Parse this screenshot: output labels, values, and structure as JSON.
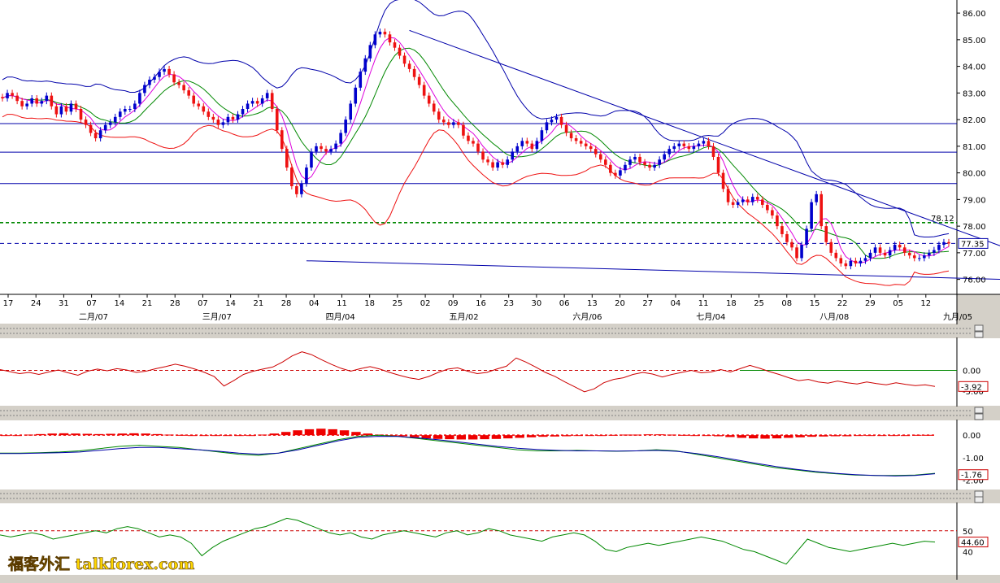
{
  "colors": {
    "bg": "#ffffff",
    "up_candle": "#0000cc",
    "down_candle": "#ee1111",
    "bollinger": "#0000aa",
    "ma_fast": "#dd00dd",
    "ma_slow": "#008800",
    "grid_hline": "#0000aa",
    "support_line": "#008800",
    "price_line": "#0000aa",
    "osc1": "#cc0000",
    "macd_signal": "#008800",
    "macd_line": "#0000aa",
    "macd_hist": "#ee0000",
    "rsi": "#008800"
  },
  "chart_data": [
    {
      "type": "candlestick",
      "y_ticks": [
        "86.00",
        "85.00",
        "84.00",
        "83.00",
        "82.00",
        "81.00",
        "80.00",
        "79.00",
        "78.00",
        "77.00",
        "76.00"
      ],
      "ylim": [
        75.5,
        86.4
      ],
      "x_ticks": [
        "17",
        "24",
        "31",
        "07",
        "14",
        "21",
        "28",
        "07",
        "14",
        "21",
        "28",
        "04",
        "11",
        "18",
        "25",
        "02",
        "09",
        "16",
        "23",
        "30",
        "06",
        "13",
        "20",
        "27",
        "04",
        "11",
        "18",
        "25",
        "08",
        "15",
        "22",
        "29",
        "05",
        "12"
      ],
      "month_labels": [
        "二月/07",
        "三月/07",
        "四月/04",
        "五月/02",
        "六月/06",
        "七月/04",
        "八月/08",
        "九月/05"
      ],
      "horizontal_levels": [
        81.85,
        80.78,
        79.6
      ],
      "reference_level": {
        "value": 78.13,
        "label": "78.12"
      },
      "current_price": {
        "value": 77.35,
        "label": "77.35"
      },
      "trendlines": [
        {
          "from": {
            "bar": 83,
            "value": 85.35
          },
          "to": {
            "bar": 229,
            "value": 75.55
          }
        },
        {
          "from": {
            "bar": 62,
            "value": 76.7
          },
          "to": {
            "bar": 245,
            "value": 75.8
          }
        }
      ],
      "close_series": [
        82.8,
        83.0,
        82.9,
        82.7,
        82.5,
        82.6,
        82.8,
        82.6,
        82.7,
        82.9,
        82.5,
        82.2,
        82.5,
        82.3,
        82.6,
        82.4,
        82.0,
        81.8,
        81.5,
        81.3,
        81.6,
        81.8,
        81.9,
        82.1,
        82.3,
        82.4,
        82.4,
        82.6,
        83.0,
        83.3,
        83.5,
        83.6,
        83.8,
        83.9,
        83.7,
        83.4,
        83.3,
        83.1,
        82.9,
        82.6,
        82.5,
        82.3,
        82.1,
        82.0,
        81.8,
        81.9,
        82.1,
        82.0,
        82.2,
        82.4,
        82.6,
        82.7,
        82.6,
        82.8,
        83.0,
        82.4,
        81.6,
        80.9,
        80.2,
        79.5,
        79.2,
        79.6,
        80.2,
        80.8,
        81.0,
        80.9,
        80.8,
        80.9,
        81.1,
        81.5,
        82.0,
        82.6,
        83.2,
        83.8,
        84.3,
        84.8,
        85.2,
        85.3,
        85.2,
        84.9,
        84.7,
        84.4,
        84.1,
        83.9,
        83.6,
        83.3,
        82.9,
        82.6,
        82.3,
        82.0,
        81.9,
        81.8,
        81.9,
        81.8,
        81.4,
        81.2,
        81.1,
        80.8,
        80.5,
        80.4,
        80.2,
        80.4,
        80.3,
        80.5,
        80.8,
        81.0,
        81.2,
        81.1,
        80.9,
        81.2,
        81.6,
        81.9,
        82.0,
        82.1,
        81.8,
        81.5,
        81.3,
        81.2,
        81.1,
        81.0,
        80.9,
        80.7,
        80.5,
        80.3,
        80.0,
        79.9,
        80.1,
        80.3,
        80.5,
        80.6,
        80.4,
        80.3,
        80.2,
        80.3,
        80.5,
        80.7,
        80.9,
        81.0,
        81.1,
        81.0,
        80.9,
        81.0,
        81.1,
        81.2,
        81.0,
        80.6,
        80.0,
        79.4,
        78.9,
        78.8,
        78.9,
        79.0,
        78.9,
        79.1,
        79.0,
        78.8,
        78.6,
        78.4,
        78.0,
        77.7,
        77.4,
        77.2,
        76.8,
        77.3,
        77.9,
        78.9,
        79.2,
        78.0,
        77.4,
        77.0,
        76.8,
        76.6,
        76.5,
        76.7,
        76.6,
        76.7,
        76.8,
        77.0,
        77.2,
        77.0,
        76.9,
        77.1,
        77.3,
        77.2,
        77.0,
        76.9,
        76.8,
        76.8,
        76.9,
        77.0,
        77.1,
        77.3,
        77.4,
        77.35
      ]
    },
    {
      "type": "line",
      "y_ticks": [
        "0.00",
        "-5.00"
      ],
      "current_value": "-3.92",
      "series": [
        {
          "values": [
            0.2,
            -0.3,
            -0.8,
            -0.5,
            -1.0,
            -0.4,
            0.1,
            -0.6,
            -1.2,
            -0.2,
            0.3,
            -0.1,
            0.4,
            0.1,
            -0.5,
            -0.2,
            0.4,
            0.9,
            1.5,
            1.0,
            0.3,
            -0.5,
            -1.5,
            -3.8,
            -2.5,
            -1.0,
            -0.2,
            0.3,
            0.8,
            2.0,
            3.5,
            4.5,
            3.8,
            2.6,
            1.5,
            0.5,
            -0.2,
            0.4,
            0.9,
            0.3,
            -0.5,
            -1.2,
            -1.8,
            -2.2,
            -1.5,
            -0.5,
            0.3,
            0.6,
            -0.2,
            -0.8,
            -0.5,
            0.3,
            1.0,
            3.0,
            2.0,
            0.8,
            -0.5,
            -1.5,
            -2.8,
            -4.0,
            -5.2,
            -4.5,
            -3.0,
            -2.2,
            -1.8,
            -1.0,
            -0.5,
            -0.9,
            -1.6,
            -1.0,
            -0.5,
            0.0,
            -0.6,
            -0.4,
            0.2,
            -0.4,
            0.4,
            1.2,
            0.5,
            -0.3,
            -1.0,
            -1.8,
            -2.5,
            -2.2,
            -2.8,
            -3.1,
            -2.6,
            -3.0,
            -3.3,
            -2.8,
            -3.2,
            -3.5,
            -3.0,
            -3.4,
            -3.7,
            -3.5,
            -3.92
          ]
        }
      ]
    },
    {
      "type": "line",
      "y_ticks": [
        "0.00",
        "-1.00",
        "-2.00"
      ],
      "current_value": "-1.76",
      "series": [
        {
          "values": [
            -0.8,
            -0.8,
            -0.78,
            -0.75,
            -0.7,
            -0.6,
            -0.5,
            -0.45,
            -0.5,
            -0.55,
            -0.65,
            -0.75,
            -0.85,
            -0.9,
            -0.8,
            -0.6,
            -0.4,
            -0.2,
            -0.05,
            0.0,
            -0.05,
            -0.15,
            -0.25,
            -0.35,
            -0.45,
            -0.55,
            -0.65,
            -0.7,
            -0.7,
            -0.68,
            -0.7,
            -0.72,
            -0.7,
            -0.65,
            -0.7,
            -0.85,
            -1.0,
            -1.15,
            -1.3,
            -1.45,
            -1.55,
            -1.65,
            -1.72,
            -1.78,
            -1.8,
            -1.8,
            -1.78,
            -1.7
          ]
        },
        {
          "values": [
            -0.82,
            -0.82,
            -0.8,
            -0.78,
            -0.75,
            -0.68,
            -0.6,
            -0.55,
            -0.55,
            -0.6,
            -0.65,
            -0.72,
            -0.8,
            -0.85,
            -0.8,
            -0.65,
            -0.45,
            -0.25,
            -0.1,
            -0.05,
            -0.06,
            -0.12,
            -0.2,
            -0.3,
            -0.4,
            -0.5,
            -0.58,
            -0.64,
            -0.68,
            -0.7,
            -0.7,
            -0.71,
            -0.7,
            -0.68,
            -0.72,
            -0.82,
            -0.95,
            -1.1,
            -1.25,
            -1.4,
            -1.52,
            -1.62,
            -1.7,
            -1.76,
            -1.8,
            -1.82,
            -1.8,
            -1.72
          ]
        }
      ],
      "histogram": [
        -0.02,
        -0.01,
        0.02,
        0.04,
        0.06,
        0.07,
        0.06,
        0.05,
        0.04,
        0.05,
        0.06,
        0.07,
        0.06,
        0.04,
        0.02,
        0.01,
        0.0,
        0.0,
        -0.01,
        -0.02,
        -0.02,
        -0.01,
        0.02,
        0.06,
        0.12,
        0.18,
        0.22,
        0.24,
        0.22,
        0.18,
        0.12,
        0.06,
        0.02,
        -0.01,
        -0.04,
        -0.08,
        -0.12,
        -0.14,
        -0.15,
        -0.16,
        -0.16,
        -0.15,
        -0.14,
        -0.12,
        -0.1,
        -0.08,
        -0.06,
        -0.05,
        -0.04,
        -0.03,
        -0.02,
        0.0,
        0.01,
        0.02,
        0.02,
        0.03,
        0.03,
        0.02,
        0.01,
        0.0,
        -0.02,
        -0.04,
        -0.07,
        -0.1,
        -0.12,
        -0.13,
        -0.12,
        -0.1,
        -0.08,
        -0.06,
        -0.05,
        -0.04,
        -0.04,
        -0.03,
        -0.02,
        -0.01,
        0.0,
        0.0,
        0.01,
        0.01
      ]
    },
    {
      "type": "line",
      "y_ticks": [
        "50",
        "40"
      ],
      "reference_level": "50",
      "current_value": "44.60",
      "series": [
        {
          "values": [
            48,
            47,
            48,
            49,
            48,
            46,
            47,
            48,
            49,
            50,
            49,
            51,
            52,
            51,
            49,
            47,
            48,
            47,
            44,
            38,
            42,
            45,
            47,
            49,
            51,
            52,
            54,
            56,
            55,
            53,
            51,
            49,
            48,
            49,
            47,
            46,
            48,
            49,
            50,
            49,
            48,
            47,
            49,
            50,
            48,
            49,
            51,
            50,
            48,
            47,
            46,
            45,
            47,
            48,
            49,
            48,
            45,
            41,
            40,
            42,
            43,
            44,
            43,
            44,
            45,
            46,
            47,
            46,
            45,
            43,
            41,
            40,
            38,
            36,
            34,
            40,
            46,
            44,
            42,
            41,
            40,
            41,
            42,
            43,
            44,
            43,
            44,
            45,
            44.6
          ]
        }
      ]
    }
  ],
  "watermark": "福客外汇 talkforex.com"
}
